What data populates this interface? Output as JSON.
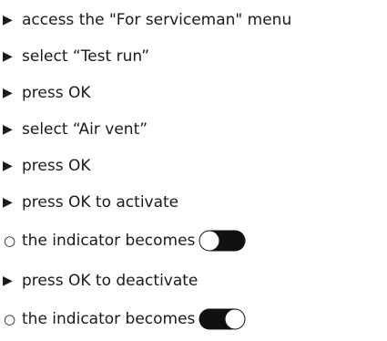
{
  "steps": [
    {
      "marker": "▶",
      "text": "access the \"For serviceman\" menu"
    },
    {
      "marker": "▶",
      "text": "select “Test run”"
    },
    {
      "marker": "▶",
      "text": "press OK"
    },
    {
      "marker": "▶",
      "text": "select “Air vent”"
    },
    {
      "marker": "▶",
      "text": "press OK"
    },
    {
      "marker": "▶",
      "text": "press OK to activate"
    },
    {
      "marker": "○",
      "text": "the indicator becomes",
      "icon": "toggle-off-icon"
    },
    {
      "marker": "▶",
      "text": "press OK to deactivate"
    },
    {
      "marker": "○",
      "text": "the indicator becomes",
      "icon": "toggle-on-icon"
    }
  ],
  "colors": {
    "text": "#1a1a1a",
    "toggle_fill": "#111111",
    "toggle_knob": "#ffffff"
  }
}
